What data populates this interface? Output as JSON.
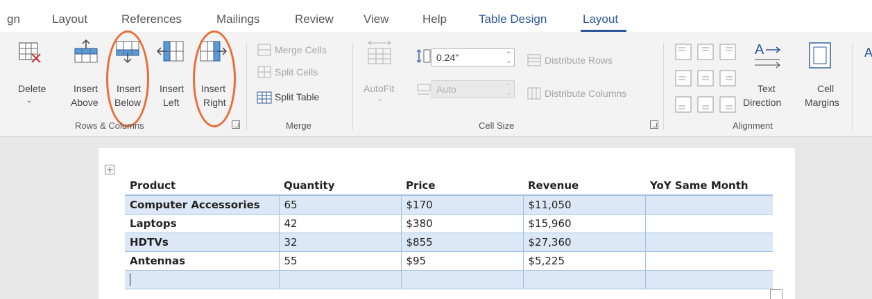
{
  "tabs": [
    {
      "label": "gn"
    },
    {
      "label": "Layout"
    },
    {
      "label": "References"
    },
    {
      "label": "Mailings"
    },
    {
      "label": "Review"
    },
    {
      "label": "View"
    },
    {
      "label": "Help"
    },
    {
      "label": "Table Design"
    },
    {
      "label": "Layout"
    }
  ],
  "ribbon": {
    "rows_columns": {
      "delete_label": "Delete",
      "insert_above": [
        "Insert",
        "Above"
      ],
      "insert_below": [
        "Insert",
        "Below"
      ],
      "insert_left": [
        "Insert",
        "Left"
      ],
      "insert_right": [
        "Insert",
        "Right"
      ],
      "group_label": "Rows & Columns"
    },
    "merge": {
      "merge_cells": "Merge Cells",
      "split_cells": "Split Cells",
      "split_table": "Split Table",
      "group_label": "Merge"
    },
    "cell_size": {
      "autofit": "AutoFit",
      "height_value": "0.24\"",
      "width_value": "Auto",
      "distribute_rows": "Distribute Rows",
      "distribute_columns": "Distribute Columns",
      "group_label": "Cell Size"
    },
    "alignment": {
      "text_direction": [
        "Text",
        "Direction"
      ],
      "cell_margins": [
        "Cell",
        "Margins"
      ],
      "group_label": "Alignment"
    }
  },
  "table": {
    "headers": [
      "Product",
      "Quantity",
      "Price",
      "Revenue",
      "YoY Same Month"
    ],
    "rows": [
      [
        "Computer Accessories",
        "65",
        "$170",
        "$11,050",
        ""
      ],
      [
        "Laptops",
        "42",
        "$380",
        "$15,960",
        ""
      ],
      [
        "HDTVs",
        "32",
        "$855",
        "$27,360",
        ""
      ],
      [
        "Antennas",
        "55",
        "$95",
        "$5,225",
        ""
      ],
      [
        "",
        "",
        "",
        "",
        ""
      ]
    ]
  },
  "colors": {
    "accent": "#2b579a",
    "highlight_oval": "#e96d35",
    "table_band": "#dce8f6",
    "table_border": "#9fc0e0"
  }
}
